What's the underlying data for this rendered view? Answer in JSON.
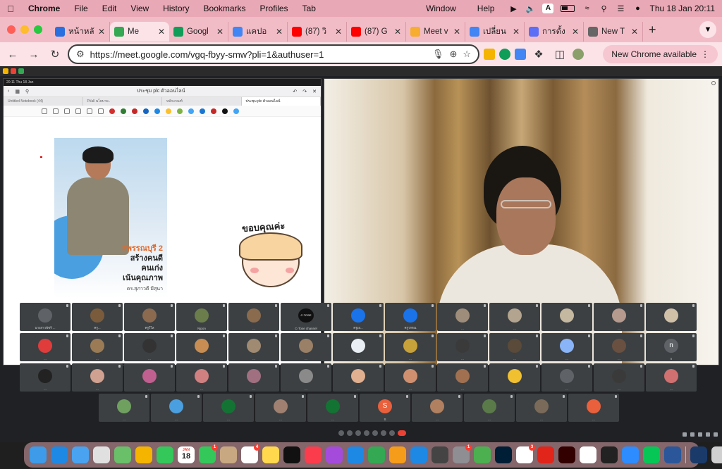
{
  "menubar": {
    "app_name": "Chrome",
    "items": [
      "File",
      "Edit",
      "View",
      "History",
      "Bookmarks",
      "Profiles",
      "Tab"
    ],
    "right_items": [
      "Window",
      "Help"
    ],
    "input_source": "A",
    "datetime": "Thu 18 Jan  20:11"
  },
  "tabs": [
    {
      "label": "หน้าหลั",
      "favicon_color": "#2a6fe0",
      "active": false
    },
    {
      "label": "Me",
      "favicon_color": "#34a853",
      "active": true
    },
    {
      "label": "Googl",
      "favicon_color": "#0f9d58",
      "active": false
    },
    {
      "label": "แคปอ",
      "favicon_color": "#4285f4",
      "active": false
    },
    {
      "label": "(87) วิ",
      "favicon_color": "#ff0000",
      "active": false
    },
    {
      "label": "(87) G",
      "favicon_color": "#ff0000",
      "active": false
    },
    {
      "label": "Meet v",
      "favicon_color": "#f6ad30",
      "active": false
    },
    {
      "label": "เปลี่ยน",
      "favicon_color": "#4285f4",
      "active": false
    },
    {
      "label": "การตั้ง",
      "favicon_color": "#5b6ef5",
      "active": false
    },
    {
      "label": "New T",
      "favicon_color": "#666666",
      "active": false
    }
  ],
  "toolbar": {
    "url": "https://meet.google.com/vgq-fbyy-smw?pli=1&authuser=1",
    "update_label": "New Chrome available"
  },
  "presentation": {
    "status_time": "20:11  Thu 18 Jan",
    "doc_title": "ประชุม plc ตัวออนไลน์",
    "tabs": [
      "Untitled Notebook (44)",
      "Pi/all นโยบาย..",
      "หลักเกณฑ์",
      "ประชุม plc ตัวออนไลน์"
    ],
    "poster_line1": "สุพรรณบุรี 2",
    "poster_line2": "สร้างคนดี",
    "poster_line3": "คนเก่ง",
    "poster_line4": "เน้นคุณภาพ",
    "poster_name": "ดร.สุภาวดี มีสุนา",
    "sticker_text": "ขอบคุณค่ะ",
    "pen_colors": [
      "#d32f2f",
      "#2e7d32",
      "#c62828",
      "#1565c0",
      "#1e88e5",
      "#fbc02d",
      "#7cb342",
      "#42a5f5",
      "#1976d2",
      "#c62828",
      "#111111",
      "#42a5f5"
    ]
  },
  "participants": [
    {
      "name": "นางสาวพัชรี ...",
      "color": "#5f6368"
    },
    {
      "name": "ครู...",
      "color": "#7a5b3c"
    },
    {
      "name": "ครูวิไล",
      "color": "#8b6a4f"
    },
    {
      "name": "Nipon",
      "color": "#6a7d4a"
    },
    {
      "name": "...",
      "color": "#8a6b4e"
    },
    {
      "name": "C-Tose channel",
      "color": "#111111",
      "initial": "C·TOSE"
    },
    {
      "name": "ครูเอ...",
      "color": "#1a73e8"
    },
    {
      "name": "ครูวรรณ",
      "color": "#1a73e8"
    },
    {
      "name": "...",
      "color": "#9e8d7a"
    },
    {
      "name": "...",
      "color": "#b3a48f"
    },
    {
      "name": "...",
      "color": "#c4b8a0"
    },
    {
      "name": "...",
      "color": "#b79a8e"
    },
    {
      "name": "...",
      "color": "#d0c0a8"
    },
    {
      "name": "...",
      "color": "#e03c3c"
    },
    {
      "name": "...",
      "color": "#9a7b55"
    },
    {
      "name": "...",
      "color": "#333333"
    },
    {
      "name": "...",
      "color": "#c88d52"
    },
    {
      "name": "...",
      "color": "#a08a72"
    },
    {
      "name": "...",
      "color": "#9a8066"
    },
    {
      "name": "...",
      "color": "#e8eef3"
    },
    {
      "name": "...",
      "color": "#c7a13a"
    },
    {
      "name": "...",
      "color": "#3a3a3a"
    },
    {
      "name": "...",
      "color": "#5a4a3a"
    },
    {
      "name": "...",
      "color": "#8ab4f8"
    },
    {
      "name": "...",
      "color": "#6a5040"
    },
    {
      "name": "n",
      "color": "#5f6368",
      "initial": "n"
    },
    {
      "name": "...",
      "color": "#222222"
    },
    {
      "name": "...",
      "color": "#d0a090"
    },
    {
      "name": "...",
      "color": "#c06090"
    },
    {
      "name": "...",
      "color": "#d08080"
    },
    {
      "name": "...",
      "color": "#a07080"
    },
    {
      "name": "...",
      "color": "#8a8a8a"
    },
    {
      "name": "...",
      "color": "#e0b090"
    },
    {
      "name": "...",
      "color": "#d09070"
    },
    {
      "name": "...",
      "color": "#a07050"
    },
    {
      "name": "...",
      "color": "#f0c030"
    },
    {
      "name": "...",
      "color": "#5f6368"
    },
    {
      "name": "...",
      "color": "#3a3a3a"
    },
    {
      "name": "...",
      "color": "#d07070"
    },
    {
      "name": "...",
      "color": "#70a060"
    },
    {
      "name": "...",
      "color": "#4a9fe0"
    },
    {
      "name": "...",
      "color": "#137333"
    },
    {
      "name": "...",
      "color": "#a08070"
    },
    {
      "name": "...",
      "color": "#137333"
    },
    {
      "name": "S",
      "color": "#e8603c",
      "initial": "S"
    },
    {
      "name": "...",
      "color": "#b08060"
    },
    {
      "name": "...",
      "color": "#5a7a4a"
    },
    {
      "name": "...",
      "color": "#7a6a5a"
    },
    {
      "name": "...",
      "color": "#e8603c"
    }
  ],
  "dock": {
    "calendar_month": "JAN",
    "calendar_day": "18",
    "apps": [
      {
        "name": "Finder",
        "color": "#3d9be9"
      },
      {
        "name": "Safari",
        "color": "#1e88e5"
      },
      {
        "name": "Mail",
        "color": "#4aa3f0"
      },
      {
        "name": "Launchpad",
        "color": "#e0e0e0"
      },
      {
        "name": "Maps",
        "color": "#6abf69"
      },
      {
        "name": "Photos",
        "color": "#f4b400"
      },
      {
        "name": "FaceTime",
        "color": "#34c759"
      },
      {
        "name": "Calendar",
        "color": "#ffffff"
      },
      {
        "name": "Messages",
        "color": "#34c759",
        "badge": "1"
      },
      {
        "name": "Contacts",
        "color": "#c8a880"
      },
      {
        "name": "Reminders",
        "color": "#ffffff",
        "badge": "4"
      },
      {
        "name": "Notes",
        "color": "#ffd84d"
      },
      {
        "name": "TV",
        "color": "#111111"
      },
      {
        "name": "Music",
        "color": "#fa3c4c"
      },
      {
        "name": "Podcasts",
        "color": "#a54bdc"
      },
      {
        "name": "Keynote",
        "color": "#1e88e5"
      },
      {
        "name": "Numbers",
        "color": "#34a853"
      },
      {
        "name": "Pages",
        "color": "#f59c1a"
      },
      {
        "name": "App Store",
        "color": "#1e88e5"
      },
      {
        "name": "QuickTime",
        "color": "#444444"
      },
      {
        "name": "System Settings",
        "color": "#8e8e93",
        "badge": "1"
      },
      {
        "name": "uTorrent",
        "color": "#4caf50"
      },
      {
        "name": "Photoshop",
        "color": "#001e36"
      },
      {
        "name": "Slack",
        "color": "#ffffff",
        "badge": "3"
      },
      {
        "name": "Acrobat",
        "color": "#e1251b"
      },
      {
        "name": "Illustrator",
        "color": "#330000"
      },
      {
        "name": "Chrome",
        "color": "#ffffff"
      },
      {
        "name": "Terminal",
        "color": "#222222"
      },
      {
        "name": "Zoom",
        "color": "#2d8cff"
      },
      {
        "name": "LINE",
        "color": "#06c755"
      },
      {
        "name": "Word",
        "color": "#2b579a"
      },
      {
        "name": "Screen Sharing",
        "color": "#1a3a6a"
      },
      {
        "name": "Trash",
        "color": "#d0d0d0"
      }
    ]
  }
}
